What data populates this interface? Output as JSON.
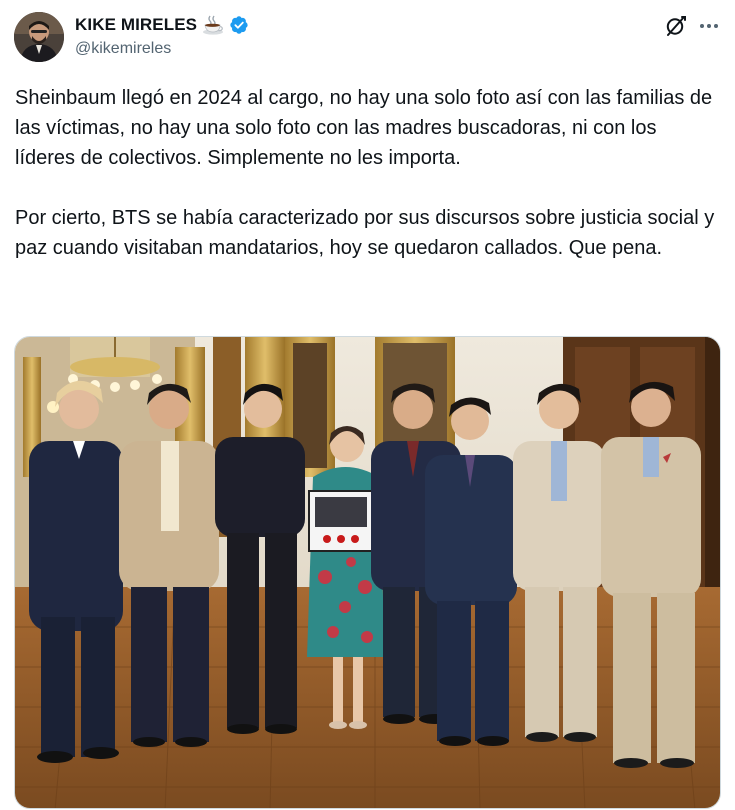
{
  "author": {
    "display_name": "KIKE MIRELES",
    "handle": "@kikemireles",
    "name_emoji": "coffee-cup-emoji",
    "verified": true,
    "verified_color": "#1d9bf0"
  },
  "header_actions": {
    "grok_icon": "grok-slash-icon",
    "more_icon": "ellipsis-icon"
  },
  "tweet": {
    "paragraph_1": "Sheinbaum llegó en 2024 al cargo, no hay una solo foto así con las familias de las víctimas, no hay una solo foto con las madres buscadoras, ni con los líderes de colectivos. Simplemente no les importa.",
    "paragraph_2": "Por cierto, BTS se había caracterizado por sus discursos sobre justicia social y paz cuando visitaban mandatarios, hoy se quedaron callados. Que pena."
  },
  "media": {
    "kind": "photo",
    "subject": "group-photo"
  },
  "colors": {
    "text_primary": "#0f1419",
    "text_secondary": "#536471",
    "border": "#cfd9de"
  }
}
